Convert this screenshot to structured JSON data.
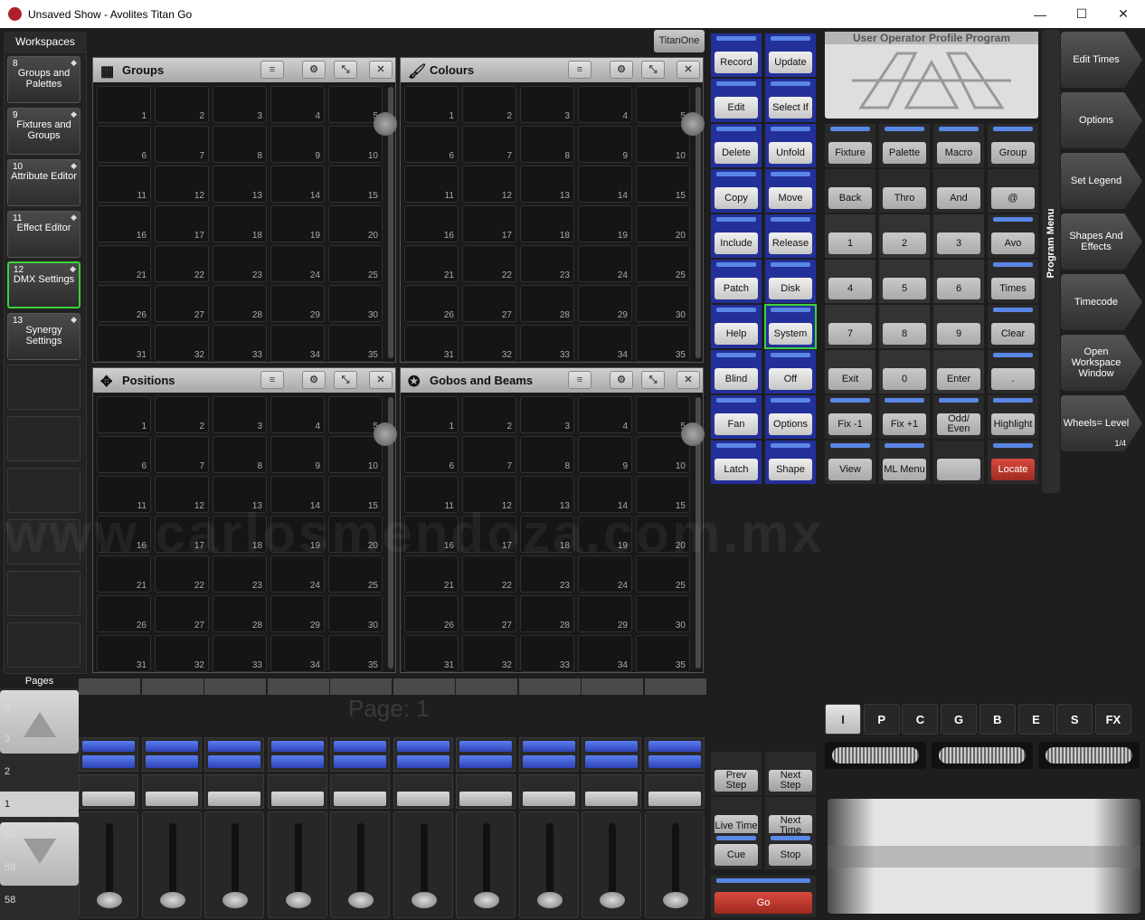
{
  "window": {
    "title": "Unsaved Show - Avolites Titan Go",
    "minimize": "—",
    "maximize": "☐",
    "close": "✕"
  },
  "workspaces": {
    "label": "Workspaces",
    "items": [
      {
        "num": "8",
        "label": "Groups and Palettes"
      },
      {
        "num": "9",
        "label": "Fixtures and Groups"
      },
      {
        "num": "10",
        "label": "Attribute Editor"
      },
      {
        "num": "11",
        "label": "Effect Editor"
      },
      {
        "num": "12",
        "label": "DMX Settings"
      },
      {
        "num": "13",
        "label": "Synergy Settings"
      }
    ]
  },
  "pages": {
    "label": "Pages",
    "numbers": [
      "4",
      "3",
      "2",
      "1",
      "60",
      "59",
      "58"
    ],
    "current": "Page: 1"
  },
  "panels": [
    {
      "title": "Groups",
      "icon": "▦"
    },
    {
      "title": "Colours",
      "icon": "🖌"
    },
    {
      "title": "Positions",
      "icon": "✥"
    },
    {
      "title": "Gobos and Beams",
      "icon": "✪"
    }
  ],
  "titanone": "TitanOne",
  "keys_left": [
    [
      "Record",
      "Update"
    ],
    [
      "Edit",
      "Select If"
    ],
    [
      "Delete",
      "Unfold"
    ],
    [
      "Copy",
      "Move"
    ],
    [
      "Include",
      "Release"
    ],
    [
      "Patch",
      "Disk"
    ],
    [
      "Help",
      "System"
    ],
    [
      "Blind",
      "Off"
    ],
    [
      "Fan",
      "Options"
    ],
    [
      "Latch",
      "Shape"
    ]
  ],
  "keypad": [
    [
      "Fixture",
      "Palette",
      "Macro",
      "Group"
    ],
    [
      "Back",
      "Thro",
      "And",
      "@"
    ],
    [
      "1",
      "2",
      "3",
      "Avo"
    ],
    [
      "4",
      "5",
      "6",
      "Times"
    ],
    [
      "7",
      "8",
      "9",
      "Clear"
    ],
    [
      "Exit",
      "0",
      "Enter",
      "."
    ],
    [
      "Fix -1",
      "Fix +1",
      "Odd/ Even",
      "Highlight"
    ],
    [
      "View",
      "ML Menu",
      "",
      "Locate"
    ]
  ],
  "user_menu": {
    "tabs": "User  Operator  Profile  Program"
  },
  "program_menu": "Program Menu",
  "soft_buttons": [
    "Edit Times",
    "Options",
    "Set Legend",
    "Shapes And Effects",
    "Timecode",
    "Open Workspace Window",
    "Wheels= Level"
  ],
  "soft_page": "1/4",
  "playback": {
    "prev_step": "Prev Step",
    "next_step": "Next Step",
    "live_time": "Live Time",
    "next_time": "Next Time",
    "cue": "Cue",
    "stop": "Stop",
    "go": "Go"
  },
  "attr_tabs": [
    "I",
    "P",
    "C",
    "G",
    "B",
    "E",
    "S",
    "FX"
  ],
  "watermark": "www.carlosmendoza.com.mx",
  "colors": {
    "accent_blue": "#23309a",
    "select_green": "#3bd23b",
    "locate_red": "#c0392b"
  }
}
